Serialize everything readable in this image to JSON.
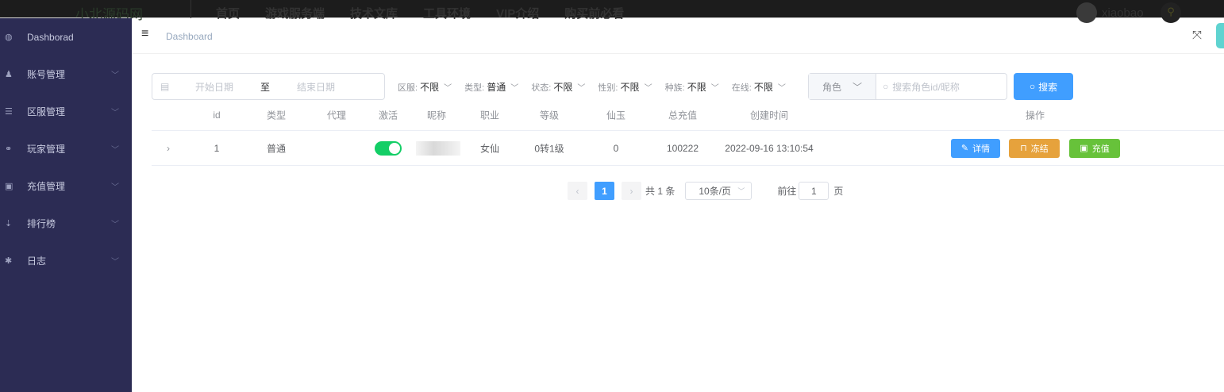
{
  "topbar": {
    "logo": "小北源码网",
    "nav": [
      "首页",
      "游戏服务端",
      "技术文库",
      "工具环境",
      "VIP介绍",
      "购买前必看"
    ],
    "user": "xiaobao"
  },
  "sidebar": {
    "items": [
      {
        "label": "Dashborad",
        "icon": "dashboard-icon",
        "expandable": false
      },
      {
        "label": "账号管理",
        "icon": "users-icon",
        "expandable": true
      },
      {
        "label": "区服管理",
        "icon": "server-list-icon",
        "expandable": true
      },
      {
        "label": "玩家管理",
        "icon": "gamepad-icon",
        "expandable": true
      },
      {
        "label": "充值管理",
        "icon": "money-icon",
        "expandable": true
      },
      {
        "label": "排行榜",
        "icon": "sort-icon",
        "expandable": true
      },
      {
        "label": "日志",
        "icon": "bug-icon",
        "expandable": true
      }
    ]
  },
  "header": {
    "breadcrumb": "Dashboard"
  },
  "filters": {
    "start_placeholder": "开始日期",
    "range_sep": "至",
    "end_placeholder": "结束日期",
    "selects": [
      {
        "label": "区服:",
        "value": "不限"
      },
      {
        "label": "类型:",
        "value": "普通"
      },
      {
        "label": "状态:",
        "value": "不限"
      },
      {
        "label": "性别:",
        "value": "不限"
      },
      {
        "label": "种族:",
        "value": "不限"
      },
      {
        "label": "在线:",
        "value": "不限"
      }
    ],
    "search_type": "角色",
    "search_placeholder": "搜索角色id/昵称",
    "search_button": "搜索"
  },
  "table": {
    "columns": [
      "id",
      "类型",
      "代理",
      "激活",
      "昵称",
      "职业",
      "等级",
      "仙玉",
      "总充值",
      "创建时间",
      "操作"
    ],
    "rows": [
      {
        "id": "1",
        "type": "普通",
        "agent": "",
        "active": true,
        "nickname": "",
        "job": "女仙",
        "level": "0转1级",
        "jade": "0",
        "total": "100222",
        "created": "2022-09-16 13:10:54"
      }
    ],
    "actions": {
      "detail": "详情",
      "freeze": "冻结",
      "recharge": "充值"
    }
  },
  "pagination": {
    "current": "1",
    "total": "共 1 条",
    "page_size": "10条/页",
    "goto_label": "前往",
    "goto_value": "1",
    "page_unit": "页"
  },
  "colors": {
    "primary": "#409eff",
    "warning": "#e6a23c",
    "success": "#67c23a",
    "switch": "#13ce66",
    "sidebar": "#2c2c54"
  }
}
